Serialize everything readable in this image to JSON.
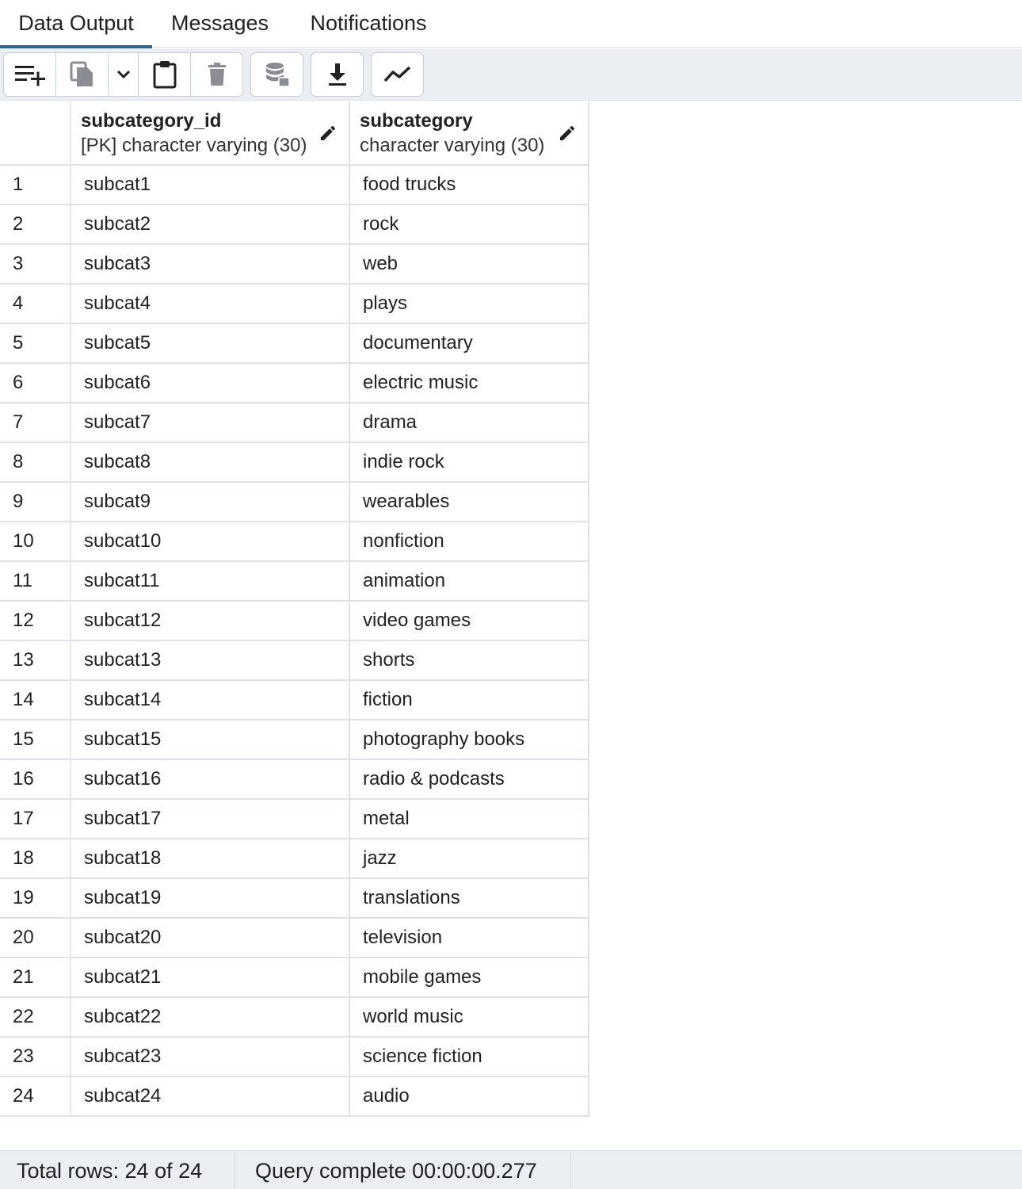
{
  "tabs": [
    {
      "label": "Data Output",
      "active": true
    },
    {
      "label": "Messages",
      "active": false
    },
    {
      "label": "Notifications",
      "active": false
    }
  ],
  "toolbar": {
    "buttons": [
      {
        "icon": "add-row-icon"
      },
      {
        "icon": "copy-icon"
      },
      {
        "icon": "chevron-down-icon"
      },
      {
        "icon": "paste-icon"
      },
      {
        "icon": "delete-icon"
      },
      {
        "icon": "save-data-icon"
      },
      {
        "icon": "download-icon"
      },
      {
        "icon": "graph-icon"
      }
    ]
  },
  "grid": {
    "columns": [
      {
        "name": "subcategory_id",
        "type": "[PK] character varying (30)"
      },
      {
        "name": "subcategory",
        "type": "character varying (30)"
      }
    ],
    "rows": [
      [
        "1",
        "subcat1",
        "food trucks"
      ],
      [
        "2",
        "subcat2",
        "rock"
      ],
      [
        "3",
        "subcat3",
        "web"
      ],
      [
        "4",
        "subcat4",
        "plays"
      ],
      [
        "5",
        "subcat5",
        "documentary"
      ],
      [
        "6",
        "subcat6",
        "electric music"
      ],
      [
        "7",
        "subcat7",
        "drama"
      ],
      [
        "8",
        "subcat8",
        "indie rock"
      ],
      [
        "9",
        "subcat9",
        "wearables"
      ],
      [
        "10",
        "subcat10",
        "nonfiction"
      ],
      [
        "11",
        "subcat11",
        "animation"
      ],
      [
        "12",
        "subcat12",
        "video games"
      ],
      [
        "13",
        "subcat13",
        "shorts"
      ],
      [
        "14",
        "subcat14",
        "fiction"
      ],
      [
        "15",
        "subcat15",
        "photography books"
      ],
      [
        "16",
        "subcat16",
        "radio & podcasts"
      ],
      [
        "17",
        "subcat17",
        "metal"
      ],
      [
        "18",
        "subcat18",
        "jazz"
      ],
      [
        "19",
        "subcat19",
        "translations"
      ],
      [
        "20",
        "subcat20",
        "television"
      ],
      [
        "21",
        "subcat21",
        "mobile games"
      ],
      [
        "22",
        "subcat22",
        "world music"
      ],
      [
        "23",
        "subcat23",
        "science fiction"
      ],
      [
        "24",
        "subcat24",
        "audio"
      ]
    ]
  },
  "status": {
    "total_rows": "Total rows: 24 of 24",
    "query": "Query complete 00:00:00.277"
  },
  "colors": {
    "active_tab_underline": "#326690",
    "toolbar_bg": "#ebeef3",
    "grid_border": "#dee1e6"
  }
}
